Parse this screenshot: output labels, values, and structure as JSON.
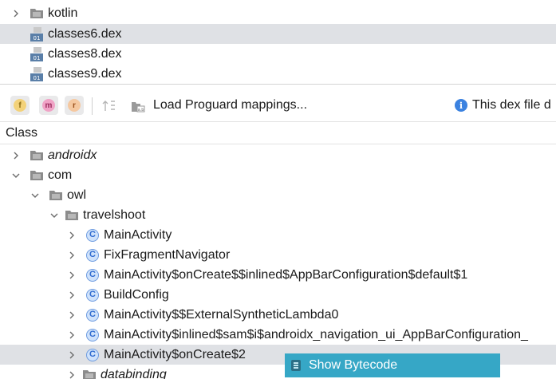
{
  "top_tree": {
    "items": [
      {
        "label": "kotlin",
        "type": "folder",
        "expandable": true,
        "selected": false
      },
      {
        "label": "classes6.dex",
        "type": "dex",
        "expandable": false,
        "selected": true
      },
      {
        "label": "classes8.dex",
        "type": "dex",
        "expandable": false,
        "selected": false
      },
      {
        "label": "classes9.dex",
        "type": "dex",
        "expandable": false,
        "selected": false
      }
    ]
  },
  "toolbar": {
    "field_filter_badge": "f",
    "method_filter_badge": "m",
    "ref_filter_badge": "r",
    "load_mappings_label": "Load Proguard mappings...",
    "info_text": "This dex file d"
  },
  "class_header": "Class",
  "class_tree": {
    "androidx": "androidx",
    "com": "com",
    "owl": "owl",
    "travelshoot": "travelshoot",
    "classes": [
      "MainActivity",
      "FixFragmentNavigator",
      "MainActivity$onCreate$$inlined$AppBarConfiguration$default$1",
      "BuildConfig",
      "MainActivity$$ExternalSyntheticLambda0",
      "MainActivity$inlined$sam$i$androidx_navigation_ui_AppBarConfiguration_",
      "MainActivity$onCreate$2"
    ],
    "databinding": "databinding",
    "class_icon_letter": "C"
  },
  "context_menu": {
    "show_bytecode": "Show Bytecode"
  },
  "colors": {
    "selection": "#dfe1e5",
    "context_highlight": "#36a7c6",
    "class_icon": "#2f6bd0"
  }
}
